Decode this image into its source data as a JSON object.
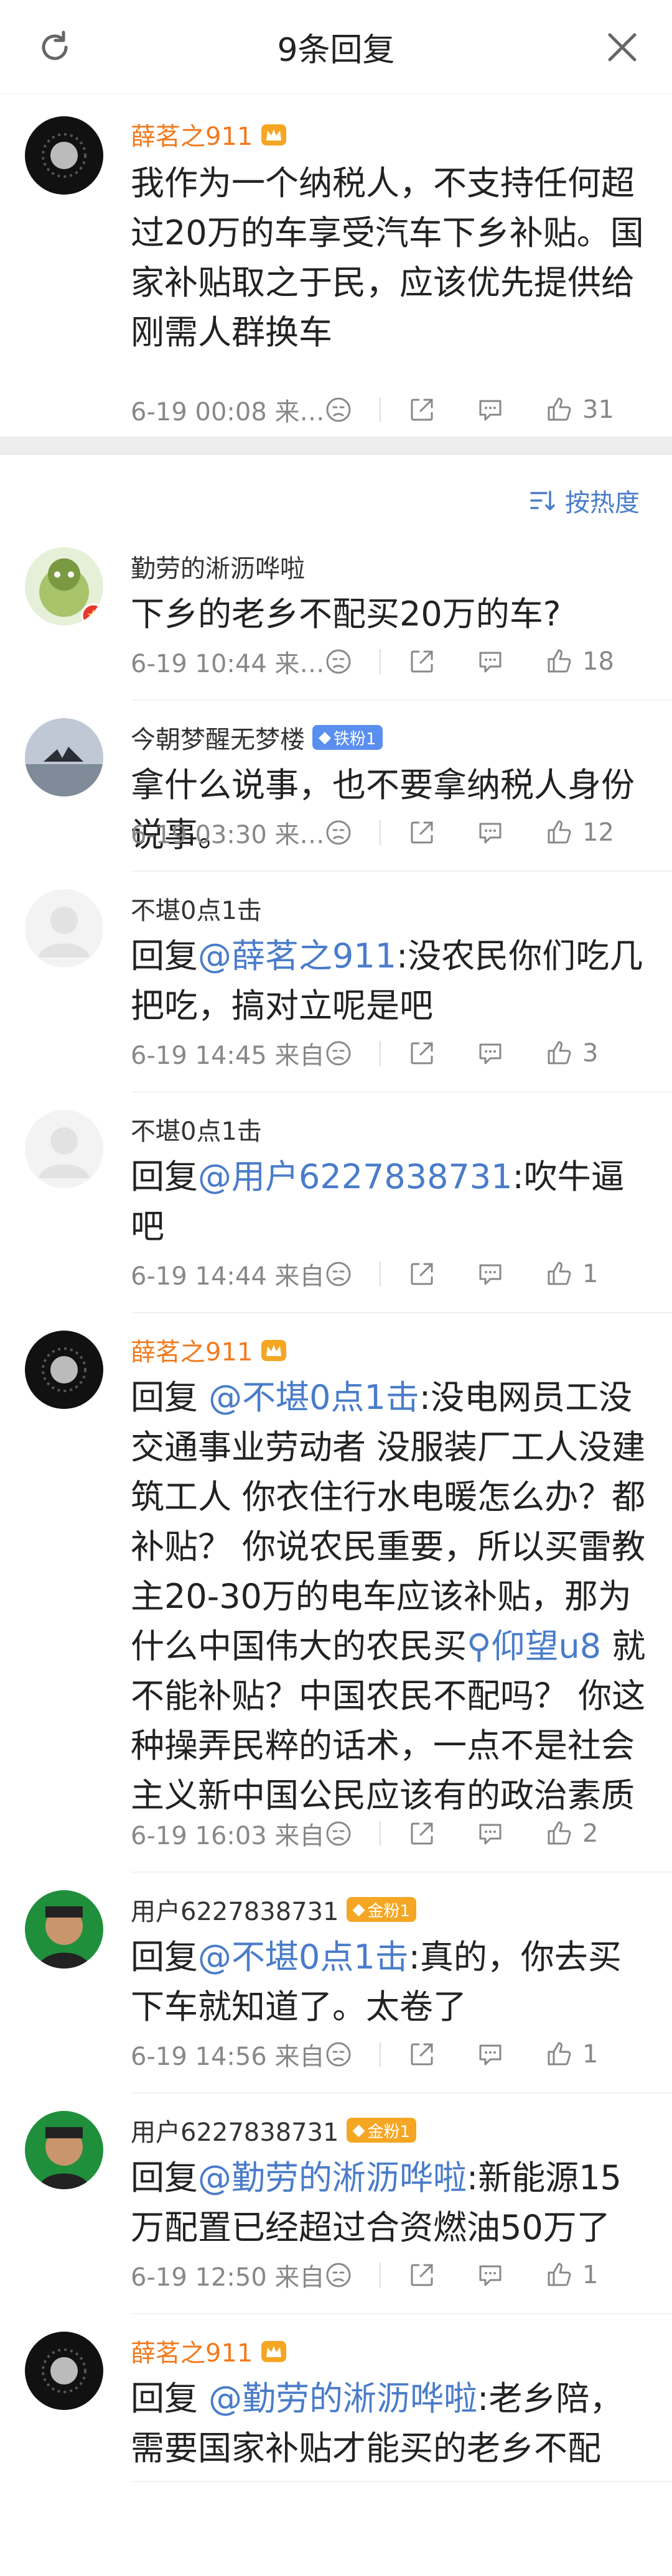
{
  "header": {
    "title": "9条回复"
  },
  "main": {
    "author": "薛茗之911",
    "text": "我作为一个纳税人，不支持任何超过20万的车享受汽车下乡补贴。国家补贴取之于民，应该优先提供给刚需人群换车",
    "time": "6-19 00:08  来…",
    "likes": "31"
  },
  "sort_label": "按热度",
  "replies": [
    {
      "author": "勤劳的淅沥哗啦",
      "badge": "",
      "text": "下乡的老乡不配买20万的车?",
      "time": "6-19 10:44  来…",
      "likes": "18"
    },
    {
      "author": "今朝梦醒无梦楼",
      "badge": "铁粉1",
      "text": "拿什么说事，也不要拿纳税人身份说事。",
      "time": "6-19 03:30  来…",
      "likes": "12"
    },
    {
      "author": "不堪0点1击",
      "badge": "",
      "prefix": "回复",
      "mention": "@薛茗之911",
      "text": ":没农民你们吃几把吃，搞对立呢是吧",
      "time": "6-19 14:45  来自…",
      "likes": "3"
    },
    {
      "author": "不堪0点1击",
      "badge": "",
      "prefix": "回复",
      "mention": "@用户6227838731",
      "text": ":吹牛逼吧",
      "time": "6-19 14:44  来自…",
      "likes": "1"
    },
    {
      "author": "薛茗之911",
      "badge": "",
      "prefix": "回复 ",
      "mention": "@不堪0点1击",
      "text": ":没电网员工没交通事业劳动者 没服装厂工人没建筑工人 你衣住行水电暖怎么办？都补贴？  你说农民重要，所以买雷教主20-30万的电车应该补贴，那为什么中国伟大的农民买",
      "search_link": "仰望u8",
      "text2": " 就不能补贴？中国农民不配吗？ 你这种操弄民粹的话术，一点不是社会主义新中国公民应该有的政治素质",
      "time": "6-19 16:03  来自…",
      "likes": "2"
    },
    {
      "author": "用户6227838731",
      "badge": "金粉1",
      "prefix": "回复",
      "mention": "@不堪0点1击",
      "text": ":真的，你去买下车就知道了。太卷了",
      "time": "6-19 14:56  来自…",
      "likes": "1"
    },
    {
      "author": "用户6227838731",
      "badge": "金粉1",
      "prefix": "回复",
      "mention": "@勤劳的淅沥哗啦",
      "text": ":新能源15万配置已经超过合资燃油50万了",
      "time": "6-19 12:50  来自…",
      "likes": "1"
    },
    {
      "author": "薛茗之911",
      "badge": "",
      "prefix": "回复 ",
      "mention": "@勤劳的淅沥哗啦",
      "text": ":老乡陪，需要国家补贴才能买的老乡不配",
      "time": "",
      "likes": ""
    }
  ],
  "colors": {
    "accent": "#4a7cc9",
    "vip_name": "#f27a1e",
    "badge_blue": "#5a8ff0",
    "badge_gold": "#f5a623"
  }
}
